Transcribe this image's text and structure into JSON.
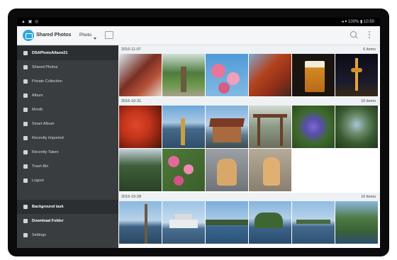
{
  "status_bar": {
    "left_icons": "▲ ▣ ◎",
    "right_text": "◂ ▾ 100% ▮ 10:50"
  },
  "app": {
    "title": "Shared Photos",
    "view_dropdown": "Photo"
  },
  "sidebar": {
    "items": [
      {
        "label": "DSAPhotoAlbum21",
        "icon": "device-icon"
      },
      {
        "label": "Shared Photos",
        "icon": "photos-icon"
      },
      {
        "label": "Private Collection",
        "icon": "lock-icon"
      },
      {
        "label": "Album",
        "icon": "album-icon"
      },
      {
        "label": "Month",
        "icon": "calendar-icon"
      },
      {
        "label": "Smart Album",
        "icon": "smart-album-icon"
      },
      {
        "label": "Recently Imported",
        "icon": "clock-icon"
      },
      {
        "label": "Recently Taken",
        "icon": "camera-icon"
      },
      {
        "label": "Trash Bin",
        "icon": "trash-icon"
      },
      {
        "label": "Logout",
        "icon": "logout-icon"
      },
      {
        "label": "Background task",
        "icon": "task-icon"
      },
      {
        "label": "Download Folder",
        "icon": "folder-icon"
      },
      {
        "label": "Settings",
        "icon": "gear-icon"
      }
    ]
  },
  "sections": [
    {
      "date": "2016-11-07",
      "count": "6 items"
    },
    {
      "date": "2016-10-31",
      "count": "10 items"
    },
    {
      "date": "2016-10-28",
      "count": "10 items"
    }
  ],
  "colors": {
    "accent": "#2fa7dd",
    "sidebar_bg": "#3a3d40",
    "header_bg": "#eef2f4"
  }
}
